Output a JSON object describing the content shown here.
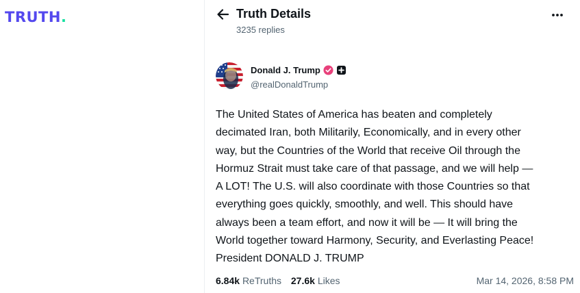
{
  "brand": {
    "logo_text": "TRUTH",
    "logo_dot": ".",
    "primary_color": "#5448ee",
    "accent_color": "#17e0a0"
  },
  "header": {
    "title": "Truth Details",
    "reply_count": "3235 replies",
    "back_icon": "arrow-left-icon",
    "more_icon": "more-horizontal-icon"
  },
  "post": {
    "author": {
      "name": "Donald J. Trump",
      "handle": "@realDonaldTrump",
      "verified_icon": "verified-badge-icon",
      "verified_color": "#e8417b",
      "extra_icon": "plus-badge-icon"
    },
    "body_lines": [
      "The United States of America has beaten and completely",
      "decimated Iran, both Militarily, Economically, and in every other",
      "way, but the Countries of the World that receive Oil through the",
      "Hormuz Strait must take care of that passage, and we will help —",
      "A LOT! The U.S. will also coordinate with those Countries so that",
      "everything goes quickly, smoothly, and well. This should have",
      "always been a team effort, and now it will be — It will bring the",
      "World together toward Harmony, Security, and Everlasting Peace!",
      "President DONALD J. TRUMP"
    ],
    "stats": {
      "retruths_count": "6.84k",
      "retruths_label": "ReTruths",
      "likes_count": "27.6k",
      "likes_label": "Likes"
    },
    "timestamp": "Mar 14, 2026, 8:58 PM"
  }
}
